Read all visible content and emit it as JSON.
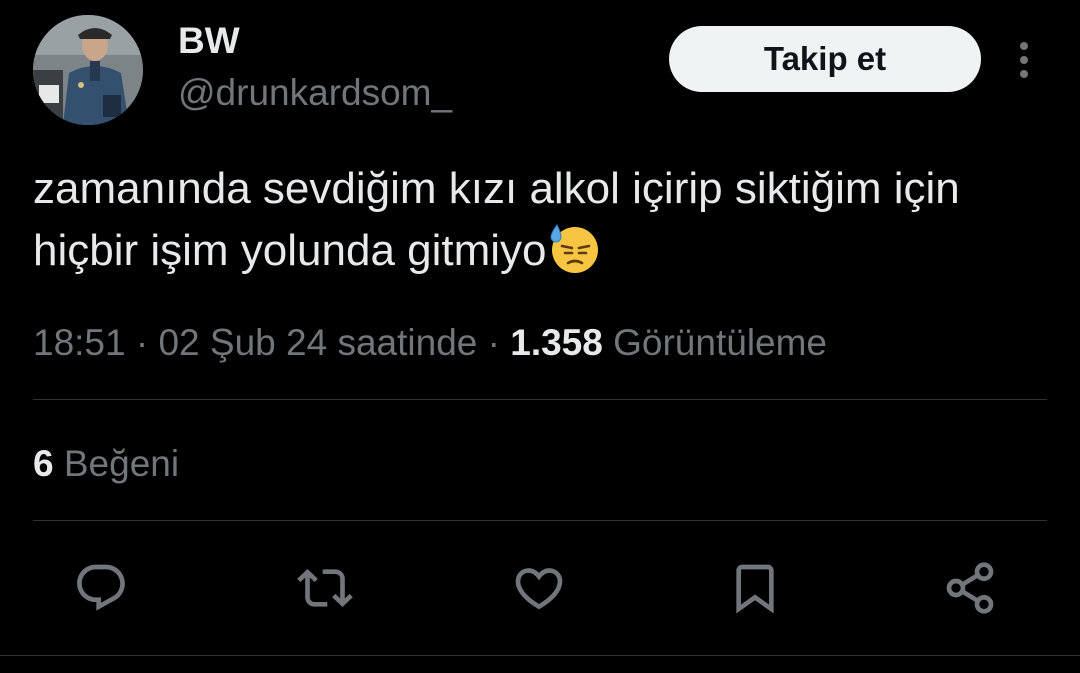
{
  "author": {
    "display_name": "BW",
    "handle": "@drunkardsom_"
  },
  "header": {
    "follow_label": "Takip et"
  },
  "tweet": {
    "text": "zamanında sevdiğim kızı alkol içirip siktiğim için hiçbir işim yolunda gitmiyo",
    "emoji": "downcast-face-with-sweat"
  },
  "meta": {
    "time": "18:51",
    "separator": "·",
    "date": "02 Şub 24 saatinde",
    "views_count": "1.358",
    "views_label": "Görüntüleme"
  },
  "stats": {
    "likes_count": "6",
    "likes_label": "Beğeni"
  },
  "actions": [
    {
      "name": "reply",
      "icon": "reply-icon"
    },
    {
      "name": "retweet",
      "icon": "retweet-icon"
    },
    {
      "name": "like",
      "icon": "heart-icon"
    },
    {
      "name": "bookmark",
      "icon": "bookmark-icon"
    },
    {
      "name": "share",
      "icon": "share-icon"
    }
  ],
  "colors": {
    "background": "#000000",
    "primary_text": "#e7e9ea",
    "secondary_text": "#71767b",
    "divider": "#2f3336",
    "follow_button_bg": "#eff3f4"
  }
}
